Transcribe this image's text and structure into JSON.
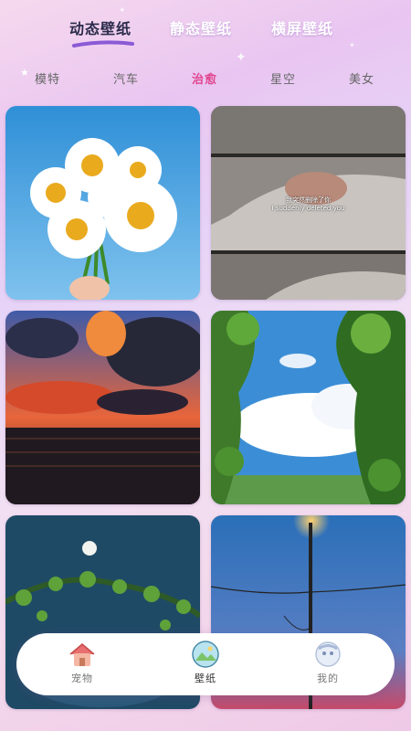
{
  "top_tabs": [
    {
      "label": "动态壁纸",
      "active": true
    },
    {
      "label": "静态壁纸",
      "active": false
    },
    {
      "label": "横屏壁纸",
      "active": false
    }
  ],
  "categories": [
    {
      "label": "模特",
      "active": false
    },
    {
      "label": "汽车",
      "active": false
    },
    {
      "label": "治愈",
      "active": true
    },
    {
      "label": "星空",
      "active": false
    },
    {
      "label": "美女",
      "active": false
    }
  ],
  "wallpapers": [
    {
      "scene": "daisy-bouquet-sky"
    },
    {
      "scene": "hands-sleeve-subtitle",
      "subtitle_cn": "我突然删除了你",
      "subtitle_en": "I suddenly deleted you"
    },
    {
      "scene": "sunset-clouds-sea"
    },
    {
      "scene": "leaves-frame-clouds"
    },
    {
      "scene": "moon-vine-night"
    },
    {
      "scene": "street-lamp-dusk"
    }
  ],
  "bottom_nav": [
    {
      "label": "宠物",
      "icon": "house-icon",
      "active": false
    },
    {
      "label": "壁纸",
      "icon": "wallpaper-icon",
      "active": true
    },
    {
      "label": "我的",
      "icon": "profile-icon",
      "active": false
    }
  ],
  "colors": {
    "accent": "#e0458f",
    "tab_underline": "#8a5ad6"
  }
}
